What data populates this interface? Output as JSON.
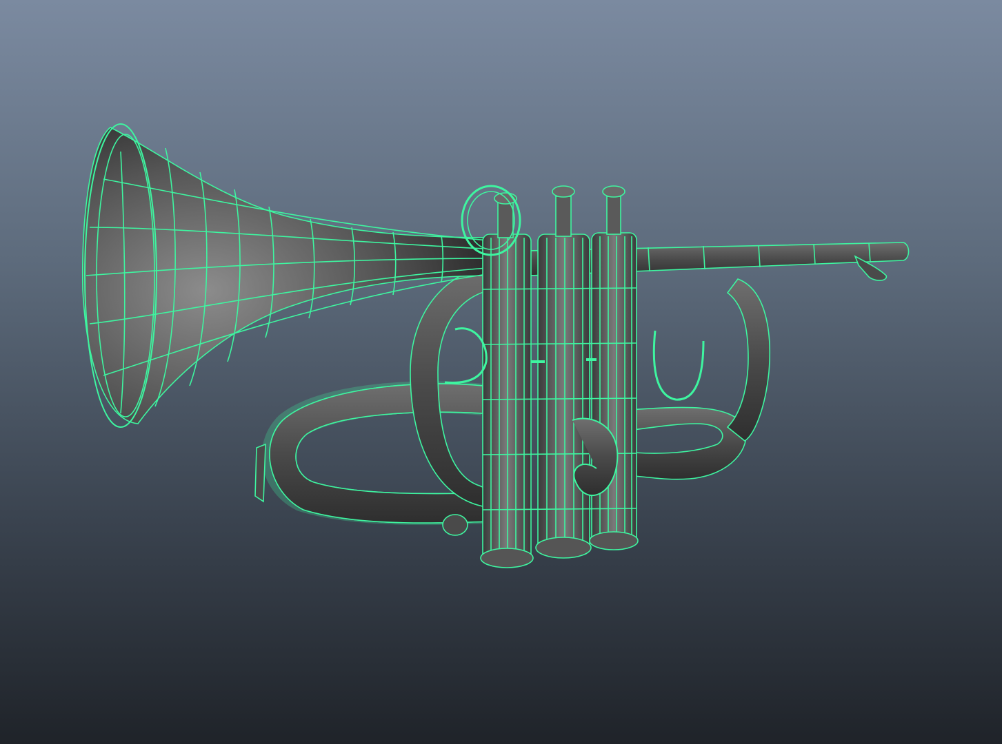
{
  "viewport": {
    "background_top": "#7b8aa0",
    "background_bottom": "#1f2329"
  },
  "model": {
    "subject": "trumpet-wireframe",
    "wire_color": "#3ef5a0",
    "shade_light": "#8a8a8a",
    "shade_dark": "#2b2b2b"
  }
}
